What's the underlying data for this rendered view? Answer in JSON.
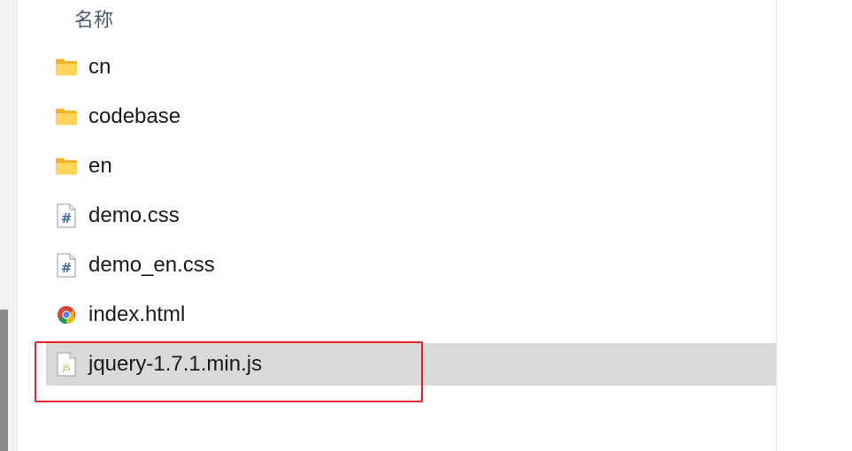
{
  "header": {
    "name_column": "名称"
  },
  "files": [
    {
      "name": "cn",
      "icon": "folder-icon",
      "type": "folder",
      "selected": false
    },
    {
      "name": "codebase",
      "icon": "folder-icon",
      "type": "folder",
      "selected": false
    },
    {
      "name": "en",
      "icon": "folder-icon",
      "type": "folder",
      "selected": false
    },
    {
      "name": "demo.css",
      "icon": "css-file-icon",
      "type": "css",
      "selected": false
    },
    {
      "name": "demo_en.css",
      "icon": "css-file-icon",
      "type": "css",
      "selected": false
    },
    {
      "name": "index.html",
      "icon": "chrome-html-icon",
      "type": "html",
      "selected": false
    },
    {
      "name": "jquery-1.7.1.min.js",
      "icon": "js-file-icon",
      "type": "js",
      "selected": true
    }
  ],
  "colors": {
    "selection": "#d9d9d9",
    "highlight_border": "#e32630",
    "folder": "#f5c542"
  }
}
